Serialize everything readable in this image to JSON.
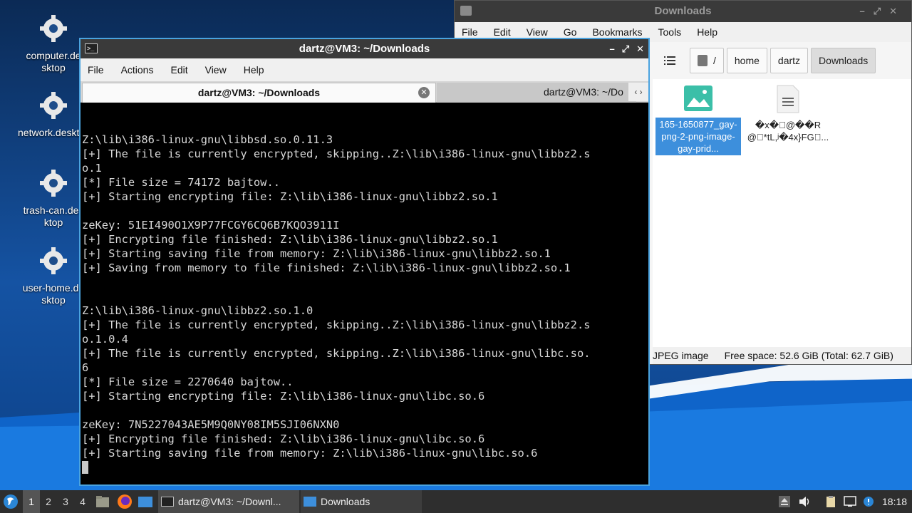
{
  "desktop": {
    "icons": [
      {
        "label": "computer.desktop"
      },
      {
        "label": "network.desktop"
      },
      {
        "label": "trash-can.desktop"
      },
      {
        "label": "user-home.desktop"
      }
    ]
  },
  "file_manager": {
    "title": "Downloads",
    "menu": [
      "File",
      "Edit",
      "View",
      "Go",
      "Bookmarks",
      "Tools",
      "Help"
    ],
    "path": [
      "/",
      "home",
      "dartz",
      "Downloads"
    ],
    "files": [
      {
        "name": "165-1650877_gay-png-2-png-image-gay-prid...",
        "selected": true
      },
      {
        "name": "�x�􏿽@��R@􏿽*tL,ʲ�4x}FG􏿽...",
        "selected": false
      }
    ],
    "status_type": "JPEG image",
    "status_space": "Free space: 52.6 GiB (Total: 62.7 GiB)"
  },
  "terminal": {
    "title": "dartz@VM3: ~/Downloads",
    "menu": [
      "File",
      "Actions",
      "Edit",
      "View",
      "Help"
    ],
    "tabs": [
      "dartz@VM3: ~/Downloads",
      "dartz@VM3: ~/Do"
    ],
    "lines": [
      "",
      "",
      "Z:\\lib\\i386-linux-gnu\\libbsd.so.0.11.3",
      "[+] The file is currently encrypted, skipping..Z:\\lib\\i386-linux-gnu\\libbz2.s",
      "o.1",
      "[*] File size = 74172 bajtow..",
      "[+] Starting encrypting file: Z:\\lib\\i386-linux-gnu\\libbz2.so.1",
      "",
      "zeKey: 51EI490O1X9P77FCGY6CQ6B7KQO3911I",
      "[+] Encrypting file finished: Z:\\lib\\i386-linux-gnu\\libbz2.so.1",
      "[+] Starting saving file from memory: Z:\\lib\\i386-linux-gnu\\libbz2.so.1",
      "[+] Saving from memory to file finished: Z:\\lib\\i386-linux-gnu\\libbz2.so.1",
      "",
      "",
      "Z:\\lib\\i386-linux-gnu\\libbz2.so.1.0",
      "[+] The file is currently encrypted, skipping..Z:\\lib\\i386-linux-gnu\\libbz2.s",
      "o.1.0.4",
      "[+] The file is currently encrypted, skipping..Z:\\lib\\i386-linux-gnu\\libc.so.",
      "6",
      "[*] File size = 2270640 bajtow..",
      "[+] Starting encrypting file: Z:\\lib\\i386-linux-gnu\\libc.so.6",
      "",
      "zeKey: 7N5227043AE5M9Q0NY08IM5SJI06NXN0",
      "[+] Encrypting file finished: Z:\\lib\\i386-linux-gnu\\libc.so.6",
      "[+] Starting saving file from memory: Z:\\lib\\i386-linux-gnu\\libc.so.6"
    ]
  },
  "taskbar": {
    "workspaces": [
      "1",
      "2",
      "3",
      "4"
    ],
    "tasks": [
      "dartz@VM3: ~/Downl...",
      "Downloads"
    ],
    "clock": "18:18"
  },
  "colors": {
    "accent": "#3d8fdc",
    "terminal_bg": "#000000",
    "titlebar": "#3a3a3a"
  }
}
